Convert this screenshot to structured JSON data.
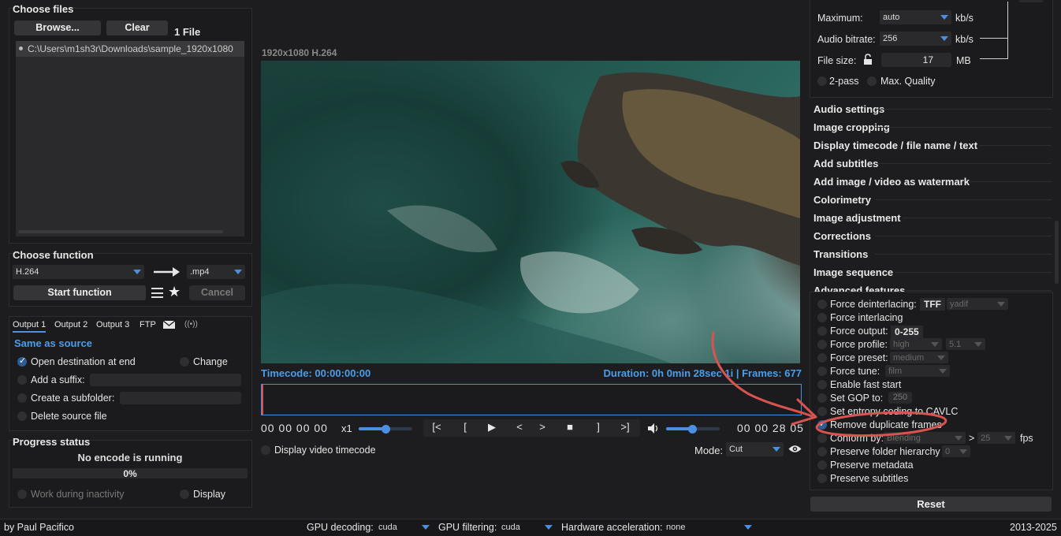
{
  "left": {
    "choose_files_title": "Choose files",
    "browse_label": "Browse...",
    "clear_label": "Clear",
    "file_count": "1 File",
    "files": [
      "C:\\Users\\m1sh3r\\Downloads\\sample_1920x1080"
    ],
    "choose_function_title": "Choose function",
    "codec": "H.264",
    "container": ".mp4",
    "start_label": "Start function",
    "cancel_label": "Cancel",
    "output_tabs": [
      "Output 1",
      "Output 2",
      "Output 3",
      "FTP"
    ],
    "same_as_source": "Same as source",
    "open_dest": "Open destination at end",
    "change": "Change",
    "add_suffix": "Add a suffix:",
    "create_subfolder": "Create a subfolder:",
    "delete_source": "Delete source file",
    "progress_title": "Progress status",
    "no_encode": "No encode is running",
    "percent": "0%",
    "work_inactivity": "Work during inactivity",
    "display": "Display"
  },
  "player": {
    "video_info": "1920x1080 H.264",
    "timecode": "Timecode: 00:00:00:00",
    "duration": "Duration: 0h 0min 28sec 1i | Frames: 677",
    "start_tc": "00 00 00 00",
    "speed": "x1",
    "controls": [
      "[<",
      "[",
      "▶",
      "<",
      ">",
      "■",
      "]",
      ">]"
    ],
    "end_tc": "00 00 28 05",
    "display_timecode": "Display video timecode",
    "mode_label": "Mode:",
    "mode_value": "Cut",
    "speed_level": 0.5,
    "volume_level": 0.5
  },
  "right": {
    "maximum_label": "Maximum:",
    "maximum_value": "auto",
    "audio_bitrate_label": "Audio bitrate:",
    "audio_bitrate_value": "256",
    "kbs": "kb/s",
    "file_size_label": "File size:",
    "file_size_value": "17",
    "mb": "MB",
    "two_pass": "2-pass",
    "max_quality": "Max. Quality",
    "sections": [
      "Audio settings",
      "Image cropping",
      "Display timecode / file name / text",
      "Add subtitles",
      "Add image / video as watermark",
      "Colorimetry",
      "Image adjustment",
      "Corrections",
      "Transitions",
      "Image sequence",
      "Advanced features"
    ],
    "adv": {
      "deinterlacing": "Force deinterlacing:",
      "tff": "TFF",
      "yadif": "yadif",
      "interlacing": "Force interlacing",
      "output": "Force output:",
      "output_range": "0-255",
      "profile": "Force profile:",
      "profile_value": "high",
      "level_value": "5.1",
      "preset": "Force preset:",
      "preset_value": "medium",
      "tune": "Force tune:",
      "tune_value": "film",
      "fast_start": "Enable fast start",
      "gop": "Set GOP to:",
      "gop_value": "250",
      "entropy": "Set entropy coding to CAVLC",
      "remove_dup": "Remove duplicate frames",
      "conform": "Conform by:",
      "conform_value": "Blending",
      "fps_value": "25",
      "fps": "fps",
      "gt": ">",
      "folder_hierarchy": "Preserve folder hierarchy",
      "folder_value": "0",
      "metadata": "Preserve metadata",
      "subtitles": "Preserve subtitles"
    },
    "reset_label": "Reset"
  },
  "status": {
    "author": "by Paul Pacifico",
    "gpu_decoding_label": "GPU decoding:",
    "gpu_decoding_value": "cuda",
    "gpu_filtering_label": "GPU filtering:",
    "gpu_filtering_value": "cuda",
    "hw_accel_label": "Hardware acceleration:",
    "hw_accel_value": "none",
    "years": "2013-2025"
  },
  "colors": {
    "accent": "#4a9eea",
    "annotation": "#d9534f",
    "background": "#1d1d1f"
  },
  "icons": [
    "menu-icon",
    "star-icon",
    "mail-icon",
    "broadcast-icon",
    "volume-icon",
    "eye-icon",
    "lock-icon",
    "arrow-right-icon"
  ]
}
